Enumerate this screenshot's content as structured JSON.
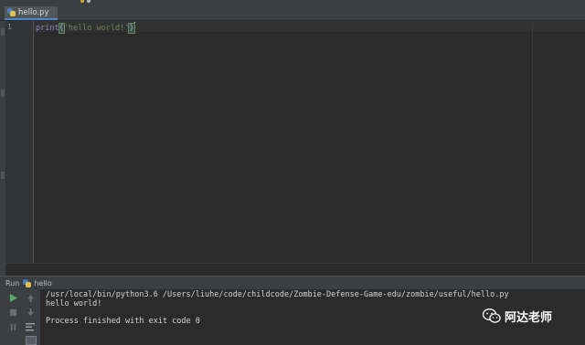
{
  "editor": {
    "tab_label": "hello.py",
    "line_number": "1",
    "code": {
      "fn": "print",
      "open_paren": "(",
      "string": "'hello world!'",
      "close_paren": ")"
    }
  },
  "run_panel": {
    "title": "Run",
    "config_name": "hello"
  },
  "console": {
    "lines": [
      "/usr/local/bin/python3.6 /Users/liuhe/code/childcode/Zombie-Defense-Game-edu/zombie/useful/hello.py",
      "hello world!",
      "",
      "Process finished with exit code 0"
    ]
  },
  "watermark": {
    "text": "阿达老师"
  },
  "colors": {
    "accent": "#4a88c7",
    "run_green": "#59a869",
    "string_green": "#6a8759",
    "function_purple": "#8888c6"
  },
  "icons": {
    "tab": "python-file-icon",
    "run": "play-icon",
    "stop": "stop-icon",
    "rerun_up": "arrow-up-icon",
    "rerun_down": "arrow-down-icon",
    "pause": "pause-icon",
    "soft_wrap": "wrap-icon",
    "watermark": "wechat-icon"
  }
}
